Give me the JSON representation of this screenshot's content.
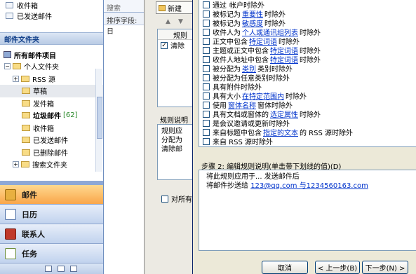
{
  "nav": {
    "favorites": [
      "收件箱",
      "已发送邮件"
    ],
    "folder_header": "邮件文件夹",
    "all_mail_label": "所有邮件项目",
    "tree": [
      {
        "label": "个人文件夹",
        "expander": "−",
        "bold": false,
        "count": ""
      },
      {
        "label": "RSS 源",
        "expander": "+",
        "bold": false,
        "count": ""
      },
      {
        "label": "草稿",
        "expander": "",
        "bold": false,
        "count": ""
      },
      {
        "label": "发件箱",
        "expander": "",
        "bold": false,
        "count": ""
      },
      {
        "label": "垃圾邮件",
        "expander": "",
        "bold": true,
        "count": "[62]"
      },
      {
        "label": "收件箱",
        "expander": "",
        "bold": false,
        "count": ""
      },
      {
        "label": "已发送邮件",
        "expander": "",
        "bold": false,
        "count": ""
      },
      {
        "label": "已删除邮件",
        "expander": "",
        "bold": false,
        "count": ""
      },
      {
        "label": "搜索文件夹",
        "expander": "+",
        "bold": false,
        "count": ""
      }
    ],
    "buttons": [
      "邮件",
      "日历",
      "联系人",
      "任务"
    ]
  },
  "middle": {
    "search_text": "搜索",
    "sort_label": "排序字段: 日"
  },
  "rules_dialog": {
    "new_rule_label": "新建",
    "list_header": "规则",
    "rule_item": "清除",
    "desc_label": "规则说明",
    "desc_lines": [
      "规则应",
      "分配为",
      "清除邮"
    ],
    "apply_all_label": "对所有"
  },
  "wizard": {
    "conditions": [
      {
        "pre": "通过",
        "link": "",
        "post": "帐户时除外",
        "checked": false
      },
      {
        "pre": "被标记为",
        "link": "重要性",
        "post": "时除外",
        "checked": false
      },
      {
        "pre": "被标记为",
        "link": "敏感度",
        "post": "时除外",
        "checked": false
      },
      {
        "pre": "收件人为",
        "link": "个人或通讯组列表",
        "post": "时除外",
        "checked": false
      },
      {
        "pre": "正文中包含",
        "link": "特定词语",
        "post": "时除外",
        "checked": false
      },
      {
        "pre": "主题或正文中包含",
        "link": "特定词语",
        "post": "时除外",
        "checked": false
      },
      {
        "pre": "收件人地址中包含",
        "link": "特定词语",
        "post": "时除外",
        "checked": false
      },
      {
        "pre": "被分配为",
        "link": "类别",
        "post": "类别时除外",
        "checked": false
      },
      {
        "pre": "被分配为任意类别时除外",
        "link": "",
        "post": "",
        "checked": false
      },
      {
        "pre": "具有附件时除外",
        "link": "",
        "post": "",
        "checked": false
      },
      {
        "pre": "具有大小",
        "link": "在特定范围内",
        "post": "时除外",
        "checked": false
      },
      {
        "pre": "使用",
        "link": "窗体名称",
        "post": "窗体时除外",
        "checked": false
      },
      {
        "pre": "具有文档或窗体的",
        "link": "选定属性",
        "post": "时除外",
        "checked": false
      },
      {
        "pre": "是会议邀请或更新时除外",
        "link": "",
        "post": "",
        "checked": false
      },
      {
        "pre": "来自标题中包含",
        "link": "指定的文本",
        "post": "的 RSS 源时除外",
        "checked": false
      },
      {
        "pre": "来自 RSS 源时除外",
        "link": "",
        "post": "",
        "checked": false
      }
    ],
    "step2_label": "步骤 2: 编辑规则说明(单击带下划线的值)(D)",
    "step2_line1": "将此规则应用于... 发送邮件后",
    "step2_line2_pre": "将邮件抄送给",
    "step2_line2_link": "123@qq.com 与1234560163.com",
    "cancel": "取消",
    "back": "< 上一步(B)",
    "next": "下一步(N) >"
  }
}
